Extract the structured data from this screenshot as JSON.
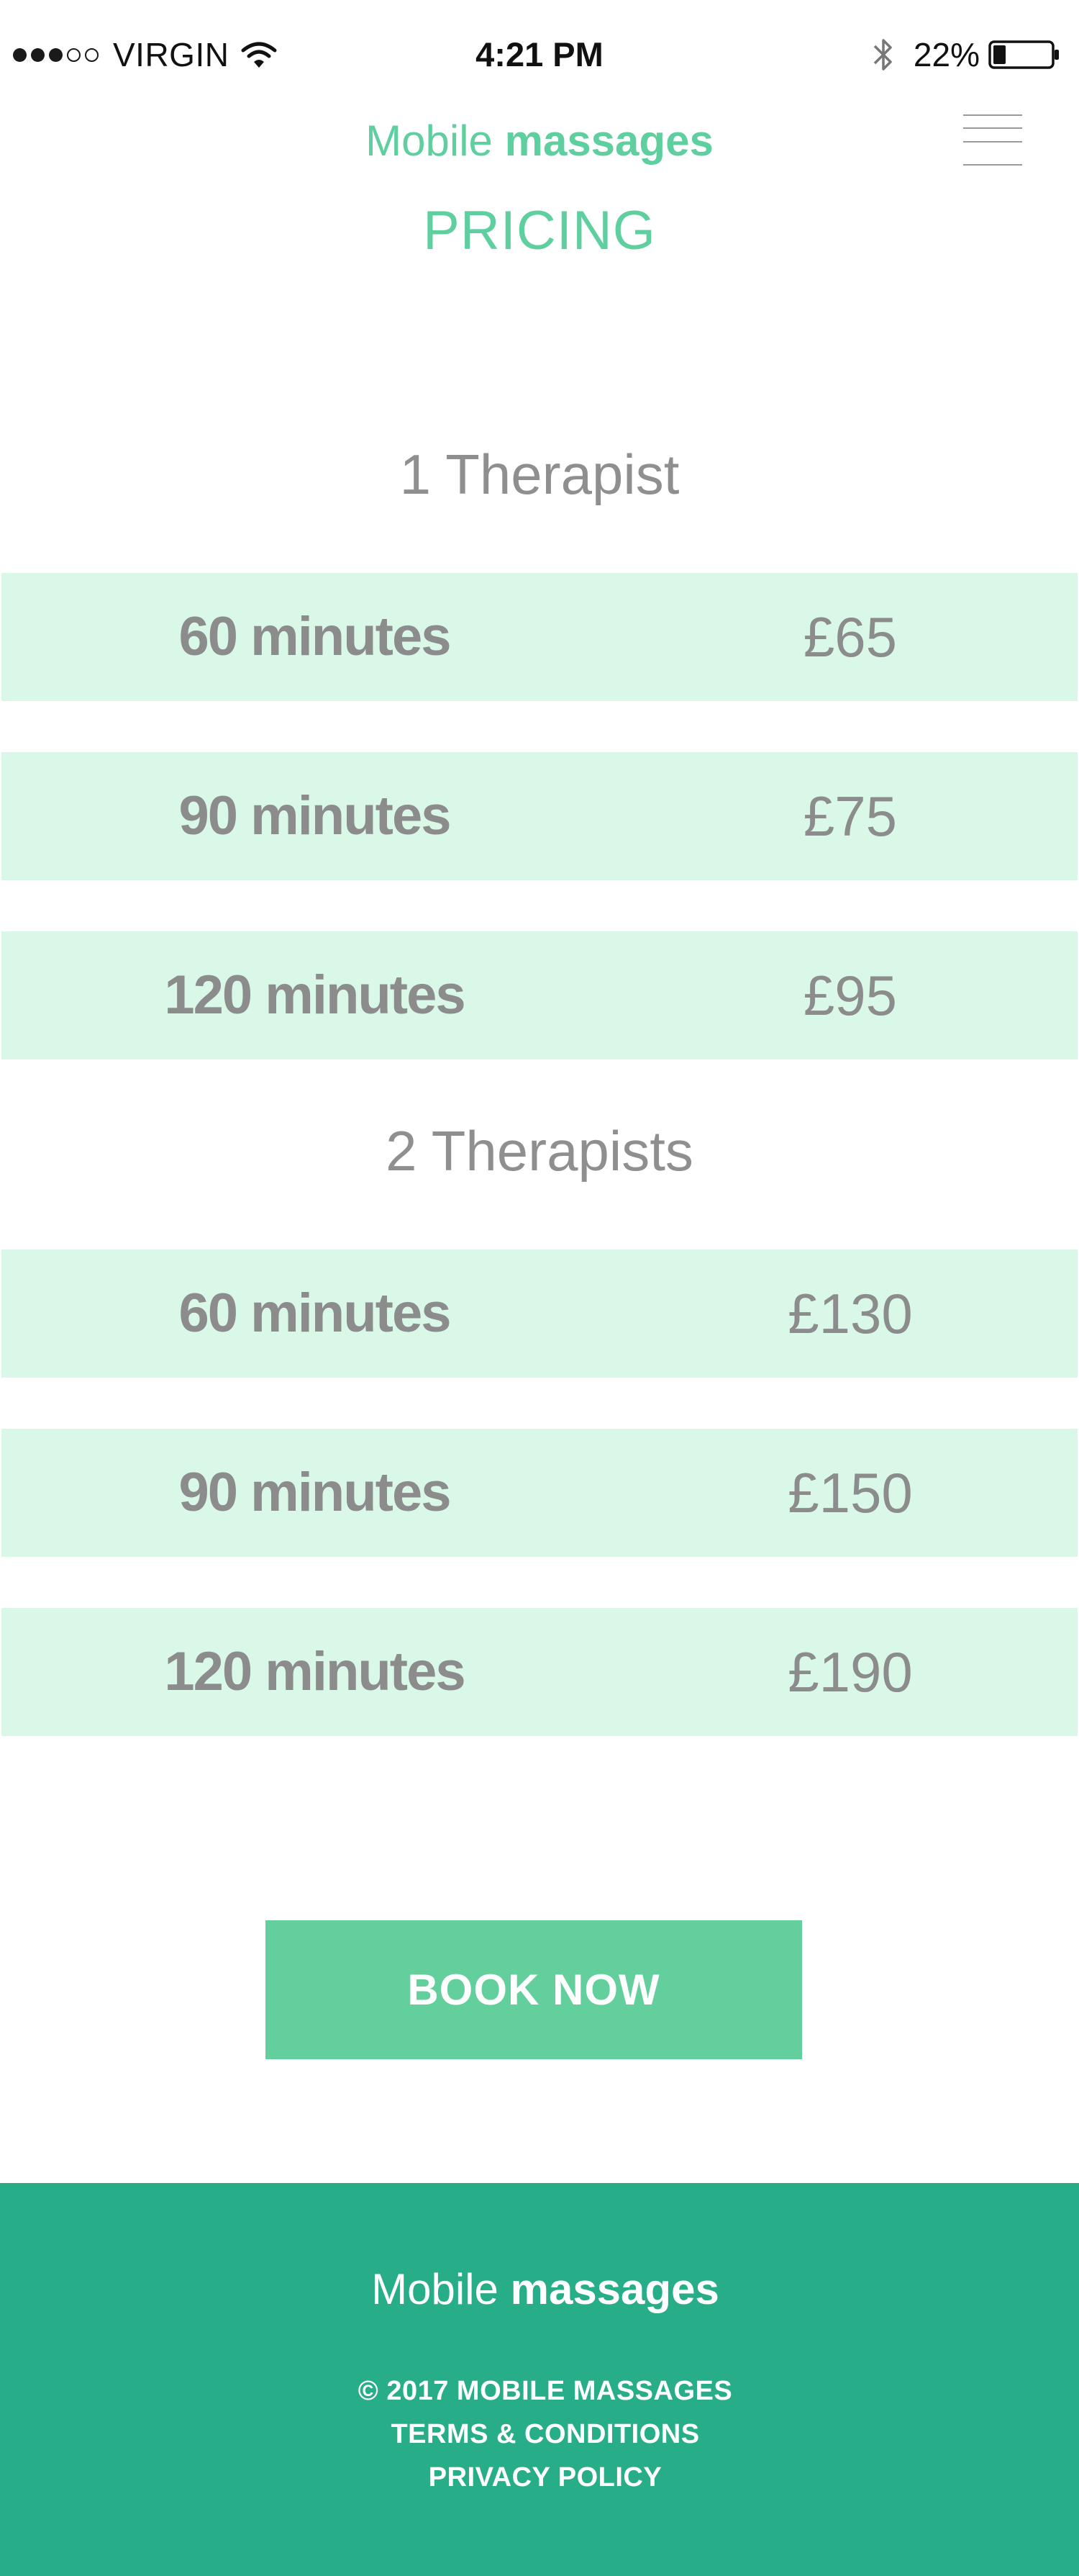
{
  "status_bar": {
    "carrier": "VIRGIN",
    "time": "4:21 PM",
    "battery_percent": "22%",
    "battery_level": 0.22,
    "signal_strength": 3,
    "signal_max": 5,
    "icons": [
      "signal-dots",
      "wifi-icon",
      "bluetooth-icon",
      "battery-icon"
    ]
  },
  "header": {
    "brand_light": "Mobile ",
    "brand_bold": "massages",
    "menu_icon": "hamburger-menu-icon",
    "page_title": "PRICING"
  },
  "pricing": {
    "groups": [
      {
        "heading": "1 Therapist",
        "rows": [
          {
            "duration": "60 minutes",
            "price": "£65"
          },
          {
            "duration": "90 minutes",
            "price": "£75"
          },
          {
            "duration": "120 minutes",
            "price": "£95"
          }
        ]
      },
      {
        "heading": "2 Therapists",
        "rows": [
          {
            "duration": "60 minutes",
            "price": "£130"
          },
          {
            "duration": "90 minutes",
            "price": "£150"
          },
          {
            "duration": "120 minutes",
            "price": "£190"
          }
        ]
      }
    ]
  },
  "cta": {
    "book_label": "BOOK NOW"
  },
  "footer": {
    "brand_light": "Mobile ",
    "brand_bold": "massages",
    "copyright": "© 2017 MOBILE MASSAGES",
    "terms_label": "TERMS & CONDITIONS",
    "privacy_label": "PRIVACY POLICY"
  },
  "colors": {
    "accent": "#5fcf9f",
    "row_background": "#d9f8e8",
    "button": "#62cf9d",
    "footer": "#28ad89",
    "text_gray": "#8c8c8c"
  }
}
